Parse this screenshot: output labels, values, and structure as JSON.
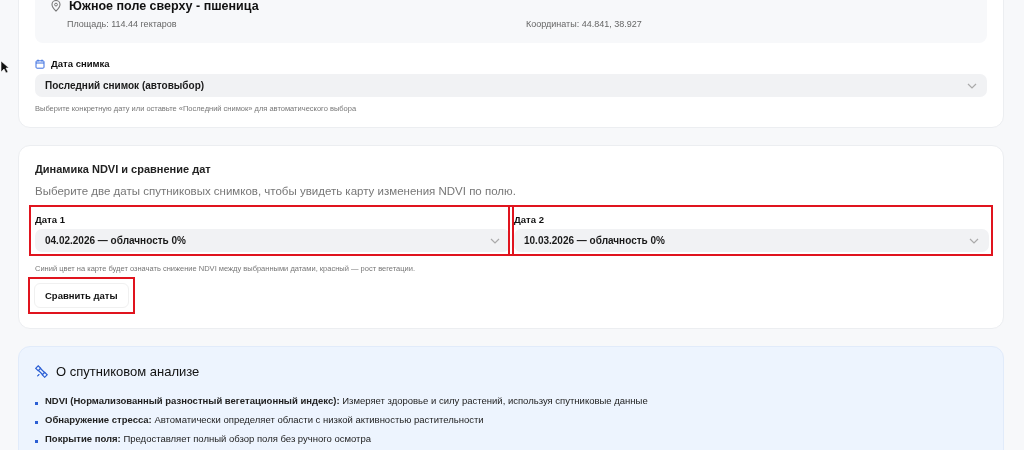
{
  "field": {
    "name": "Южное поле сверху - пшеница",
    "area": "Площадь: 114.44 гектаров",
    "coordinates": "Координаты: 44.841, 38.927"
  },
  "snapshot_date": {
    "label": "Дата снимка",
    "value": "Последний снимок (автовыбор)",
    "hint": "Выберите конкретную дату или оставьте «Последний снимок» для автоматического выбора"
  },
  "ndvi_compare": {
    "title": "Динамика NDVI и сравнение дат",
    "subtitle": "Выберите две даты спутниковых снимков, чтобы увидеть карту изменения NDVI по полю.",
    "dates": [
      {
        "label": "Дата 1",
        "value": "04.02.2026 — облачность 0%",
        "highlighted": true
      },
      {
        "label": "Дата 2",
        "value": "10.03.2026 — облачность 0%",
        "highlighted": true
      }
    ],
    "hint": "Синий цвет на карте будет означать снижение NDVI между выбранными датами, красный — рост вегетации.",
    "button": {
      "label": "Сравнить даты",
      "highlighted": true
    }
  },
  "about": {
    "title": "О спутниковом анализе",
    "items": [
      "**NDVI (Нормализованный разностный вегетационный индекс):** Измеряет здоровье и силу растений, используя спутниковые данные",
      "**Обнаружение стресса:** Автоматически определяет области с низкой активностью растительности",
      "**Покрытие поля:** Предоставляет полный обзор поля без ручного осмотра"
    ]
  }
}
